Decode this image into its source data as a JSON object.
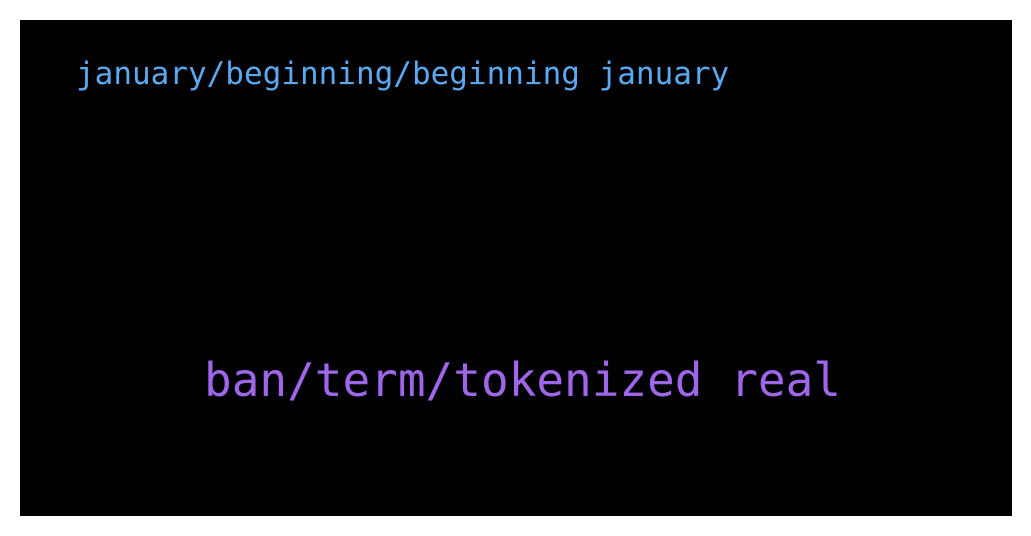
{
  "texts": {
    "top_line": "january/beginning/beginning january",
    "bottom_line": "ban/term/tokenized real"
  },
  "colors": {
    "background": "#000000",
    "border": "#ffffff",
    "top_line": "#5aa9f0",
    "bottom_line": "#a066ea"
  }
}
